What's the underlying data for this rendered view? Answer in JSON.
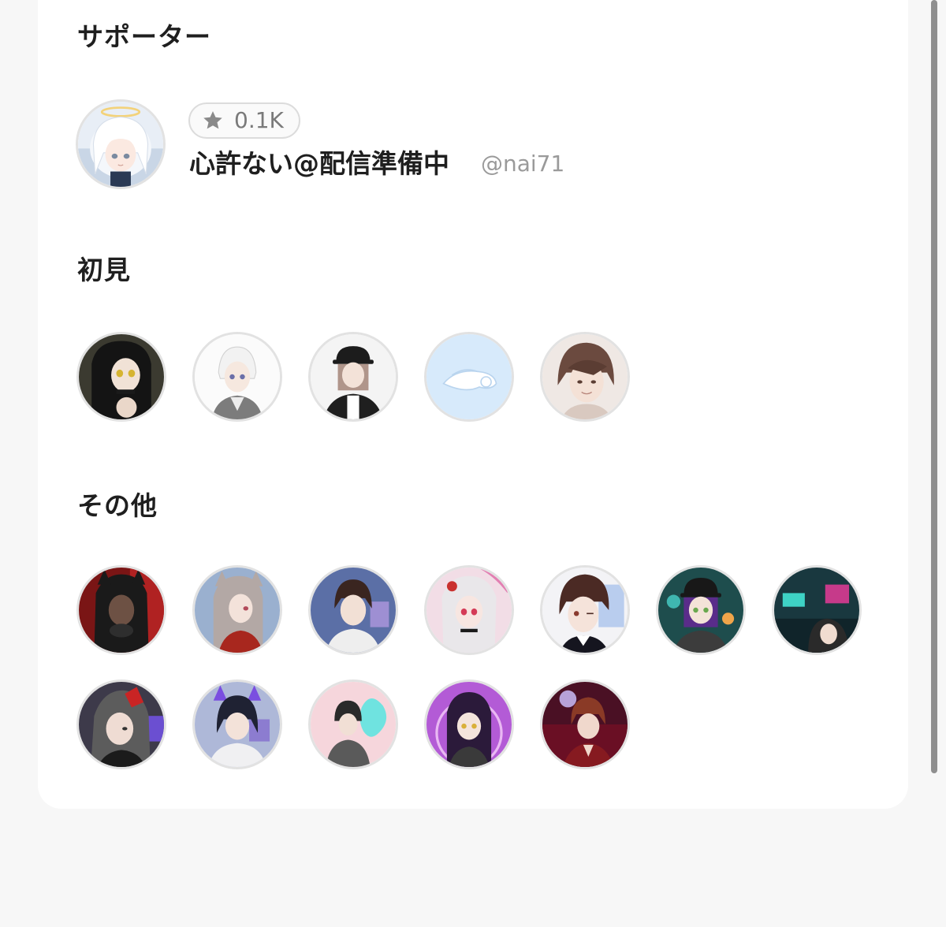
{
  "sections": {
    "supporter_title": "サポーター",
    "first_title": "初見",
    "other_title": "その他"
  },
  "supporter": {
    "badge_icon": "star-icon",
    "badge_value": "0.1K",
    "name": "心許ない@配信準備中",
    "handle": "@nai71"
  },
  "first_viewers_count": 5,
  "others_count": 12,
  "colors": {
    "card_background": "#ffffff",
    "page_background": "#f7f7f7",
    "heading_text": "#1f1f1f",
    "muted_text": "#9a9a9a",
    "avatar_border": "#e2e2e2"
  }
}
